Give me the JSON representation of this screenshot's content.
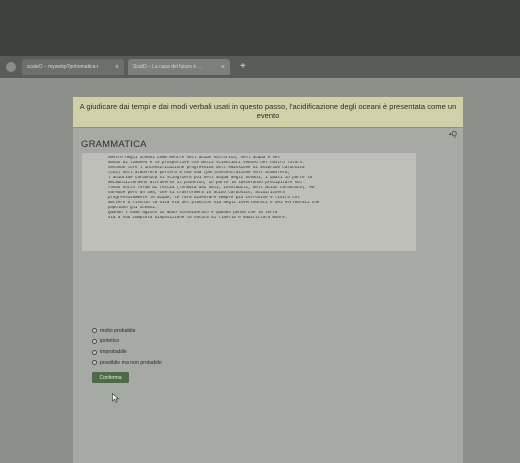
{
  "browser": {
    "tabs": [
      {
        "title": "scaleO – mywebp?pnhomatica-i",
        "close": "×",
        "active": false
      },
      {
        "title": "ScalO – La casa del futuro è …",
        "close": "×",
        "active": true
      }
    ],
    "new_tab": "+"
  },
  "banner": {
    "prompt": "A giudicare dai tempi e dai modi verbali usati in questo passo, l'acidificazione degli oceani è presentata come un evento"
  },
  "section": {
    "title": "GRAMMATICA",
    "corner_icon_text": "Q"
  },
  "passage": {
    "lines": [
      {
        "num": "",
        "text": "Mentre negli oceani come mentre nell'acido solforico, nell'acqua e nel"
      },
      {
        "num": "",
        "text": "mondo di limones è le prospettive che molti scienziati vedono nel nostro futuro."
      },
      {
        "num": "",
        "text": "Secondo loro l'intensificazione progressiva dell'emissione di anidride carbonica"
      },
      {
        "num": "",
        "text": "(CO2) nell'atmosfera porterà a una sua (per)concentrazione nell'atmosfera,"
      },
      {
        "num": "5",
        "text": "l'anidride carbonica si scioglierà poi nell'acqua degli oceani, i quali in parte la"
      },
      {
        "num": "",
        "text": "metabolizzeranno attraverso il plancton, in parte la lasceranno precipitare sul"
      },
      {
        "num": "",
        "text": "fondo sotto forma di roccia (formata dai sali, insolubili, dell'acido carbonico). Ma"
      },
      {
        "num": "",
        "text": "sarebbe però un 30%, che si trasformerà in acido carbonico, acidificherà"
      },
      {
        "num": "",
        "text": "progressivamente le acque, le farà diventare sempre più corrosive e finirà col"
      },
      {
        "num": "10",
        "text": "mettere a rischio la vita sia del plancton sia degli invertebrati e dei vertebrati che"
      },
      {
        "num": "",
        "text": "popolano gli oceani."
      },
      {
        "num": "",
        "text": "Quando l'uomo agisce in modo sconsiderato e quando pensa che la terra"
      },
      {
        "num": "",
        "text": "sia a sua completa disposizione la natura si ribella e addirittura muore."
      }
    ]
  },
  "options": [
    {
      "label": "molto probabile"
    },
    {
      "label": "ipotetico"
    },
    {
      "label": "improbabile"
    },
    {
      "label": "possibile ma non probabile"
    }
  ],
  "confirm_label": "Conferma",
  "colors": {
    "banner_bg": "#d2d0a8",
    "content_bg": "#a7aaa4",
    "button_bg": "#4e6b48"
  }
}
